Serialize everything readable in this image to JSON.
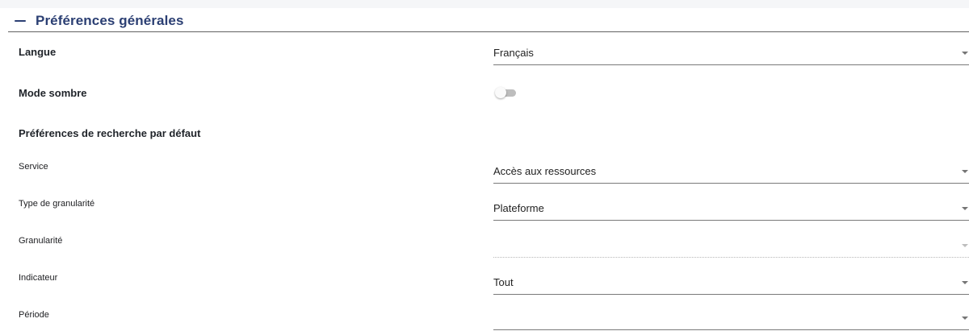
{
  "section": {
    "title": "Préférences générales",
    "collapse_icon": "minus-icon",
    "accent_color": "#2b3f73"
  },
  "general": {
    "language": {
      "label": "Langue",
      "value": "Français"
    },
    "dark_mode": {
      "label": "Mode sombre",
      "enabled": false
    }
  },
  "search_defaults": {
    "heading": "Préférences de recherche par défaut",
    "fields": {
      "service": {
        "label": "Service",
        "value": "Accès aux ressources"
      },
      "granularity_type": {
        "label": "Type de granularité",
        "value": "Plateforme"
      },
      "granularity": {
        "label": "Granularité",
        "value": "",
        "disabled": true
      },
      "indicator": {
        "label": "Indicateur",
        "value": "Tout"
      },
      "period": {
        "label": "Période",
        "value": ""
      }
    }
  }
}
